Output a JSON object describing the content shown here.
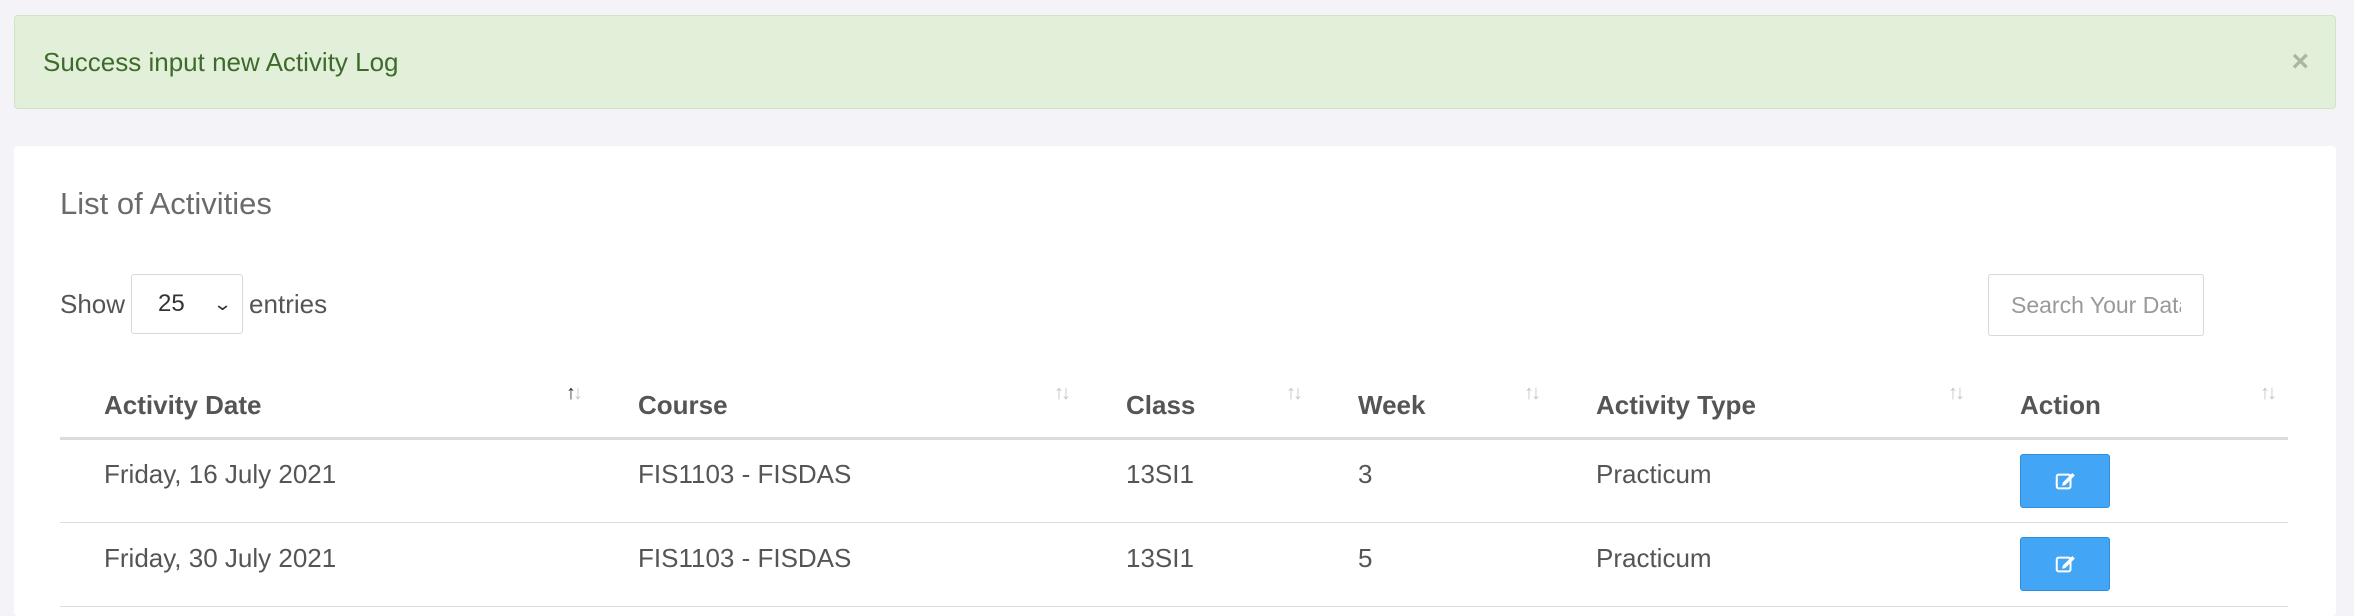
{
  "alert": {
    "message": "Success input new Activity Log",
    "close_glyph": "×"
  },
  "card": {
    "title": "List of Activities",
    "length": {
      "show_label": "Show",
      "selected": "25",
      "entries_label": "entries"
    },
    "search": {
      "placeholder": "Search Your Data"
    }
  },
  "table": {
    "columns": [
      "Activity Date",
      "Course",
      "Class",
      "Week",
      "Activity Type",
      "Action"
    ],
    "sorted_column": "Activity Date",
    "rows": [
      {
        "date": "Friday, 16 July 2021",
        "course": "FIS1103 - FISDAS",
        "class": "13SI1",
        "week": "3",
        "type": "Practicum",
        "action_icon": "edit-icon"
      },
      {
        "date": "Friday, 30 July 2021",
        "course": "FIS1103 - FISDAS",
        "class": "13SI1",
        "week": "5",
        "type": "Practicum",
        "action_icon": "edit-icon"
      }
    ]
  },
  "colors": {
    "alert_bg": "#e2f0da",
    "alert_text": "#3d6b2b",
    "button": "#42a5f5",
    "page_bg": "#f4f4f8"
  }
}
